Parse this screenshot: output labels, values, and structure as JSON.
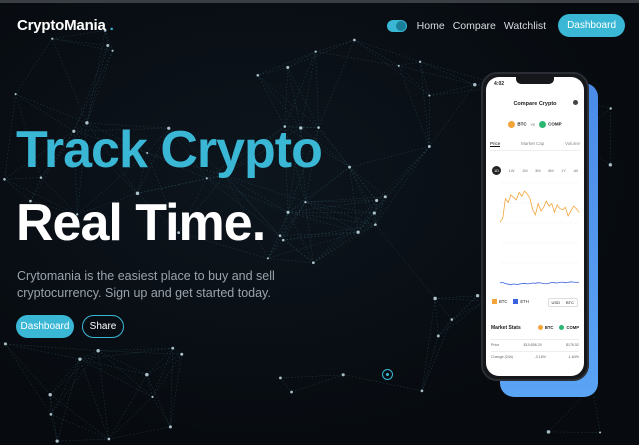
{
  "brand": {
    "name": "CryptoMania",
    "dot": ".",
    "accent": "#3bb7d6"
  },
  "nav": {
    "items": [
      "Home",
      "Compare",
      "Watchlist"
    ],
    "dashboard_label": "Dashboard",
    "theme_toggle_icon": "toggle-icon"
  },
  "hero": {
    "line1": "Track Crypto",
    "line2": "Real Time.",
    "description": "Crytomania is the easiest place to buy and sell cryptocurrency. Sign up and get started today.",
    "primary_button": "Dashboard",
    "secondary_button": "Share"
  },
  "phone": {
    "time": "4:02",
    "title": "Compare Crypto",
    "coin1": "BTC",
    "vs": "vs",
    "coin2": "COMP",
    "tabs": [
      "Price",
      "Market Cap",
      "Volume"
    ],
    "ranges": [
      "1D",
      "1W",
      "1M",
      "3M",
      "6M",
      "1Y",
      "All"
    ],
    "legend": [
      "BTC",
      "ETH"
    ],
    "toggle": [
      "USD",
      "BTC"
    ],
    "stats_title": "Market Stats",
    "stats_coins": [
      "BTC",
      "COMP"
    ],
    "stats_rows": [
      {
        "label": "Price",
        "a": "$19,658.29",
        "b": "$176.52"
      },
      {
        "label": "Change (24h)",
        "a": "-3.16%",
        "b": "-1.84%"
      }
    ]
  },
  "chart_data": {
    "type": "line",
    "series": [
      {
        "name": "BTC",
        "color": "#f5a43a",
        "values": [
          40,
          46,
          78,
          72,
          84,
          80,
          76,
          88,
          82,
          90,
          86,
          78,
          60,
          52,
          70,
          58,
          64,
          74,
          66,
          70,
          56,
          68,
          62,
          60,
          64,
          50,
          58,
          66,
          62,
          56
        ]
      },
      {
        "name": "ETH",
        "color": "#3b63e0",
        "values": [
          20,
          22,
          18,
          16,
          14,
          17,
          15,
          16,
          18,
          19,
          17,
          18,
          20,
          19,
          21,
          20,
          18,
          17,
          19,
          22,
          21,
          20,
          22,
          23,
          21,
          22,
          24,
          23,
          22,
          23
        ]
      }
    ]
  }
}
